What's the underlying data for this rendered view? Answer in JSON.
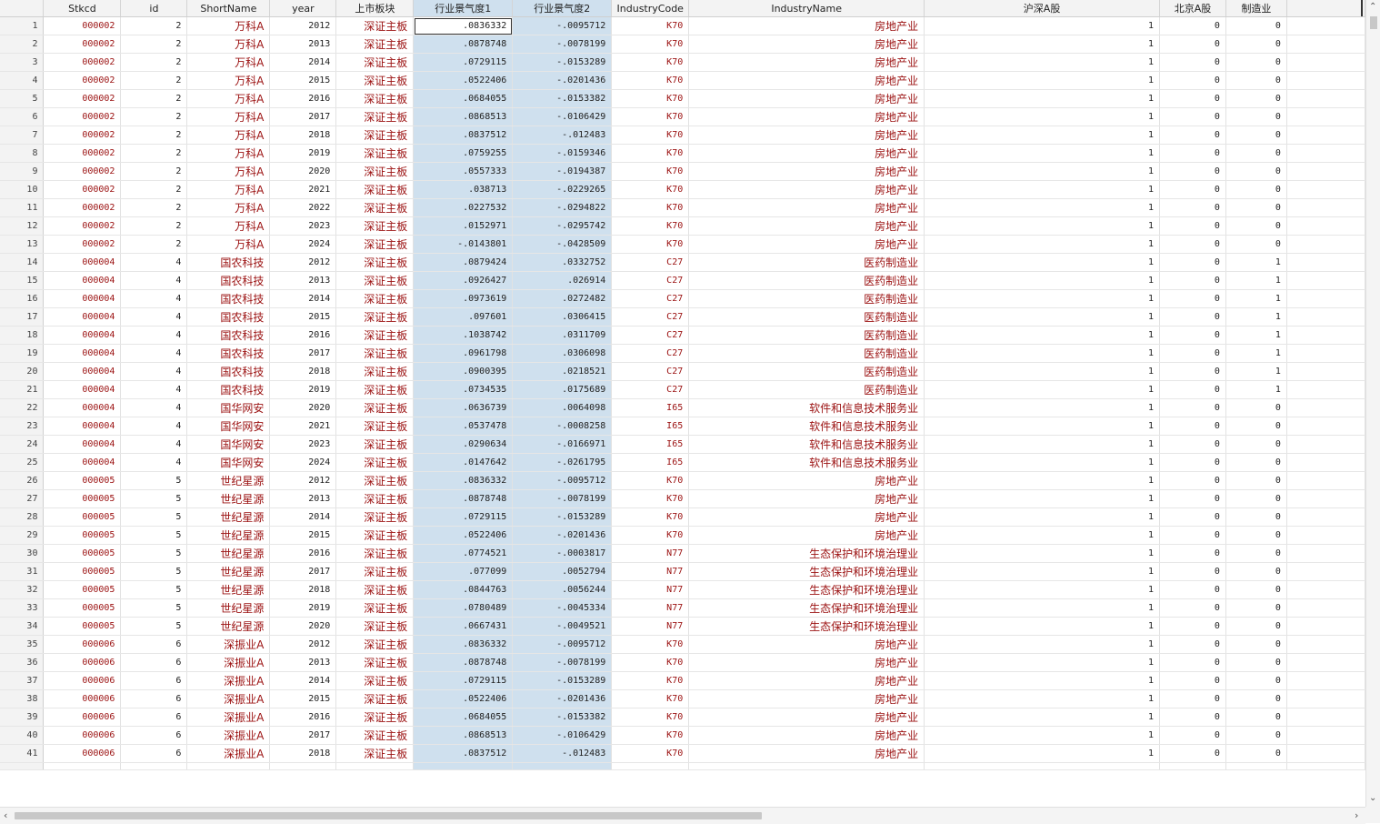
{
  "columns": [
    "Stkcd",
    "id",
    "ShortName",
    "year",
    "上市板块",
    "行业景气度1",
    "行业景气度2",
    "IndustryCode",
    "IndustryName",
    "沪深A股",
    "北京A股",
    "制造业"
  ],
  "rows": [
    [
      "1",
      "000002",
      "2",
      "万科A",
      "2012",
      "深证主板",
      ".0836332",
      "-.0095712",
      "K70",
      "房地产业",
      "1",
      "0",
      "0"
    ],
    [
      "2",
      "000002",
      "2",
      "万科A",
      "2013",
      "深证主板",
      ".0878748",
      "-.0078199",
      "K70",
      "房地产业",
      "1",
      "0",
      "0"
    ],
    [
      "3",
      "000002",
      "2",
      "万科A",
      "2014",
      "深证主板",
      ".0729115",
      "-.0153289",
      "K70",
      "房地产业",
      "1",
      "0",
      "0"
    ],
    [
      "4",
      "000002",
      "2",
      "万科A",
      "2015",
      "深证主板",
      ".0522406",
      "-.0201436",
      "K70",
      "房地产业",
      "1",
      "0",
      "0"
    ],
    [
      "5",
      "000002",
      "2",
      "万科A",
      "2016",
      "深证主板",
      ".0684055",
      "-.0153382",
      "K70",
      "房地产业",
      "1",
      "0",
      "0"
    ],
    [
      "6",
      "000002",
      "2",
      "万科A",
      "2017",
      "深证主板",
      ".0868513",
      "-.0106429",
      "K70",
      "房地产业",
      "1",
      "0",
      "0"
    ],
    [
      "7",
      "000002",
      "2",
      "万科A",
      "2018",
      "深证主板",
      ".0837512",
      "-.012483",
      "K70",
      "房地产业",
      "1",
      "0",
      "0"
    ],
    [
      "8",
      "000002",
      "2",
      "万科A",
      "2019",
      "深证主板",
      ".0759255",
      "-.0159346",
      "K70",
      "房地产业",
      "1",
      "0",
      "0"
    ],
    [
      "9",
      "000002",
      "2",
      "万科A",
      "2020",
      "深证主板",
      ".0557333",
      "-.0194387",
      "K70",
      "房地产业",
      "1",
      "0",
      "0"
    ],
    [
      "10",
      "000002",
      "2",
      "万科A",
      "2021",
      "深证主板",
      ".038713",
      "-.0229265",
      "K70",
      "房地产业",
      "1",
      "0",
      "0"
    ],
    [
      "11",
      "000002",
      "2",
      "万科A",
      "2022",
      "深证主板",
      ".0227532",
      "-.0294822",
      "K70",
      "房地产业",
      "1",
      "0",
      "0"
    ],
    [
      "12",
      "000002",
      "2",
      "万科A",
      "2023",
      "深证主板",
      ".0152971",
      "-.0295742",
      "K70",
      "房地产业",
      "1",
      "0",
      "0"
    ],
    [
      "13",
      "000002",
      "2",
      "万科A",
      "2024",
      "深证主板",
      "-.0143801",
      "-.0428509",
      "K70",
      "房地产业",
      "1",
      "0",
      "0"
    ],
    [
      "14",
      "000004",
      "4",
      "国农科技",
      "2012",
      "深证主板",
      ".0879424",
      ".0332752",
      "C27",
      "医药制造业",
      "1",
      "0",
      "1"
    ],
    [
      "15",
      "000004",
      "4",
      "国农科技",
      "2013",
      "深证主板",
      ".0926427",
      ".026914",
      "C27",
      "医药制造业",
      "1",
      "0",
      "1"
    ],
    [
      "16",
      "000004",
      "4",
      "国农科技",
      "2014",
      "深证主板",
      ".0973619",
      ".0272482",
      "C27",
      "医药制造业",
      "1",
      "0",
      "1"
    ],
    [
      "17",
      "000004",
      "4",
      "国农科技",
      "2015",
      "深证主板",
      ".097601",
      ".0306415",
      "C27",
      "医药制造业",
      "1",
      "0",
      "1"
    ],
    [
      "18",
      "000004",
      "4",
      "国农科技",
      "2016",
      "深证主板",
      ".1038742",
      ".0311709",
      "C27",
      "医药制造业",
      "1",
      "0",
      "1"
    ],
    [
      "19",
      "000004",
      "4",
      "国农科技",
      "2017",
      "深证主板",
      ".0961798",
      ".0306098",
      "C27",
      "医药制造业",
      "1",
      "0",
      "1"
    ],
    [
      "20",
      "000004",
      "4",
      "国农科技",
      "2018",
      "深证主板",
      ".0900395",
      ".0218521",
      "C27",
      "医药制造业",
      "1",
      "0",
      "1"
    ],
    [
      "21",
      "000004",
      "4",
      "国农科技",
      "2019",
      "深证主板",
      ".0734535",
      ".0175689",
      "C27",
      "医药制造业",
      "1",
      "0",
      "1"
    ],
    [
      "22",
      "000004",
      "4",
      "国华网安",
      "2020",
      "深证主板",
      ".0636739",
      ".0064098",
      "I65",
      "软件和信息技术服务业",
      "1",
      "0",
      "0"
    ],
    [
      "23",
      "000004",
      "4",
      "国华网安",
      "2021",
      "深证主板",
      ".0537478",
      "-.0008258",
      "I65",
      "软件和信息技术服务业",
      "1",
      "0",
      "0"
    ],
    [
      "24",
      "000004",
      "4",
      "国华网安",
      "2023",
      "深证主板",
      ".0290634",
      "-.0166971",
      "I65",
      "软件和信息技术服务业",
      "1",
      "0",
      "0"
    ],
    [
      "25",
      "000004",
      "4",
      "国华网安",
      "2024",
      "深证主板",
      ".0147642",
      "-.0261795",
      "I65",
      "软件和信息技术服务业",
      "1",
      "0",
      "0"
    ],
    [
      "26",
      "000005",
      "5",
      "世纪星源",
      "2012",
      "深证主板",
      ".0836332",
      "-.0095712",
      "K70",
      "房地产业",
      "1",
      "0",
      "0"
    ],
    [
      "27",
      "000005",
      "5",
      "世纪星源",
      "2013",
      "深证主板",
      ".0878748",
      "-.0078199",
      "K70",
      "房地产业",
      "1",
      "0",
      "0"
    ],
    [
      "28",
      "000005",
      "5",
      "世纪星源",
      "2014",
      "深证主板",
      ".0729115",
      "-.0153289",
      "K70",
      "房地产业",
      "1",
      "0",
      "0"
    ],
    [
      "29",
      "000005",
      "5",
      "世纪星源",
      "2015",
      "深证主板",
      ".0522406",
      "-.0201436",
      "K70",
      "房地产业",
      "1",
      "0",
      "0"
    ],
    [
      "30",
      "000005",
      "5",
      "世纪星源",
      "2016",
      "深证主板",
      ".0774521",
      "-.0003817",
      "N77",
      "生态保护和环境治理业",
      "1",
      "0",
      "0"
    ],
    [
      "31",
      "000005",
      "5",
      "世纪星源",
      "2017",
      "深证主板",
      ".077099",
      ".0052794",
      "N77",
      "生态保护和环境治理业",
      "1",
      "0",
      "0"
    ],
    [
      "32",
      "000005",
      "5",
      "世纪星源",
      "2018",
      "深证主板",
      ".0844763",
      ".0056244",
      "N77",
      "生态保护和环境治理业",
      "1",
      "0",
      "0"
    ],
    [
      "33",
      "000005",
      "5",
      "世纪星源",
      "2019",
      "深证主板",
      ".0780489",
      "-.0045334",
      "N77",
      "生态保护和环境治理业",
      "1",
      "0",
      "0"
    ],
    [
      "34",
      "000005",
      "5",
      "世纪星源",
      "2020",
      "深证主板",
      ".0667431",
      "-.0049521",
      "N77",
      "生态保护和环境治理业",
      "1",
      "0",
      "0"
    ],
    [
      "35",
      "000006",
      "6",
      "深振业A",
      "2012",
      "深证主板",
      ".0836332",
      "-.0095712",
      "K70",
      "房地产业",
      "1",
      "0",
      "0"
    ],
    [
      "36",
      "000006",
      "6",
      "深振业A",
      "2013",
      "深证主板",
      ".0878748",
      "-.0078199",
      "K70",
      "房地产业",
      "1",
      "0",
      "0"
    ],
    [
      "37",
      "000006",
      "6",
      "深振业A",
      "2014",
      "深证主板",
      ".0729115",
      "-.0153289",
      "K70",
      "房地产业",
      "1",
      "0",
      "0"
    ],
    [
      "38",
      "000006",
      "6",
      "深振业A",
      "2015",
      "深证主板",
      ".0522406",
      "-.0201436",
      "K70",
      "房地产业",
      "1",
      "0",
      "0"
    ],
    [
      "39",
      "000006",
      "6",
      "深振业A",
      "2016",
      "深证主板",
      ".0684055",
      "-.0153382",
      "K70",
      "房地产业",
      "1",
      "0",
      "0"
    ],
    [
      "40",
      "000006",
      "6",
      "深振业A",
      "2017",
      "深证主板",
      ".0868513",
      "-.0106429",
      "K70",
      "房地产业",
      "1",
      "0",
      "0"
    ],
    [
      "41",
      "000006",
      "6",
      "深振业A",
      "2018",
      "深证主板",
      ".0837512",
      "-.012483",
      "K70",
      "房地产业",
      "1",
      "0",
      "0"
    ]
  ]
}
